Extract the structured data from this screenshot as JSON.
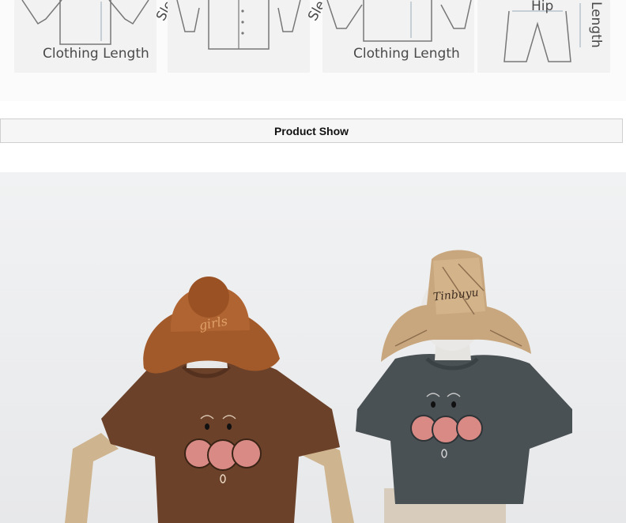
{
  "size_guide": {
    "labels": {
      "shirt_length": "Clothing Length",
      "jacket_length": "Clothing Length",
      "sleeve_1": "Sle",
      "sleeve_2": "Sle",
      "hip": "Hip",
      "pants_length": "Length"
    }
  },
  "section": {
    "title": "Product Show"
  },
  "product_photo": {
    "hat_embroidery_left": "girls",
    "hat_embroidery_right": "Tinbuyu",
    "colors": {
      "brown_tee": "#6b4129",
      "gray_tee": "#4a5155",
      "left_hat": "#a35a2a",
      "right_hat": "#c9a77e",
      "cheeks": "#d98a85"
    }
  }
}
